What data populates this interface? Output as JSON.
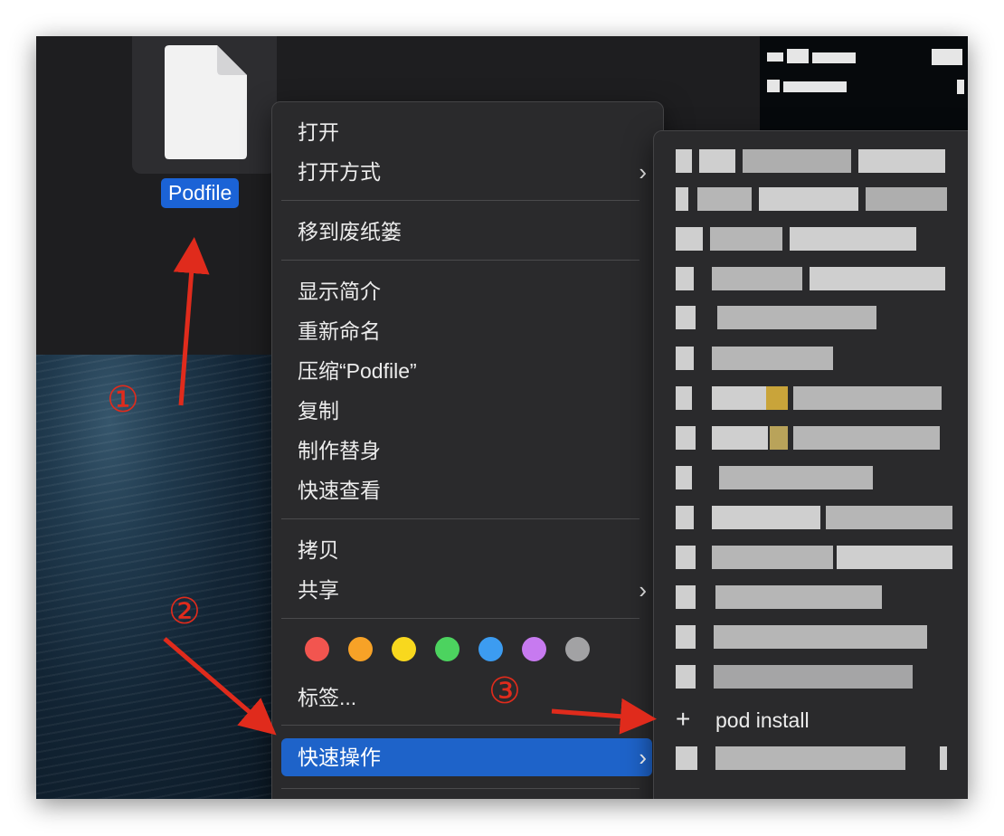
{
  "file": {
    "name": "Podfile",
    "icon": "document-icon"
  },
  "context_menu": {
    "open": "打开",
    "open_with": "打开方式",
    "move_to_trash": "移到废纸篓",
    "get_info": "显示简介",
    "rename": "重新命名",
    "compress": "压缩“Podfile”",
    "duplicate": "复制",
    "make_alias": "制作替身",
    "quick_look": "快速查看",
    "copy": "拷贝",
    "share": "共享",
    "tags": "标签...",
    "quick_actions": "快速操作",
    "submenu_chevron": "›",
    "tag_colors": [
      "#f2554f",
      "#f7a227",
      "#f8d81e",
      "#4cd35f",
      "#3c9cf1",
      "#c77af0",
      "#a2a2a4"
    ]
  },
  "quick_actions_submenu": {
    "pod_install": "pod install",
    "plus_icon": "+"
  },
  "annotations": {
    "step1": "①",
    "step2": "②",
    "step3": "③",
    "arrow_color": "#e02b1c"
  }
}
